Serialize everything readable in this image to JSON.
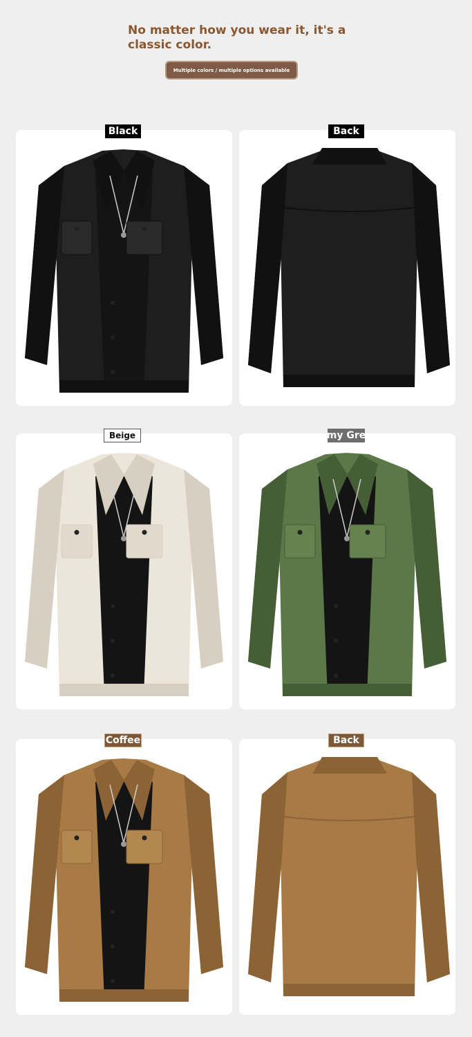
{
  "header": {
    "headline": "No matter how you wear it, it's a\nclassic color.",
    "badge": "Multiple colors / multiple options available"
  },
  "products": [
    {
      "label": "Black",
      "view": "front",
      "color": "#1e1e1e",
      "shade": "#111111",
      "pocket": "#2a2a2a"
    },
    {
      "label": "Back",
      "view": "back",
      "color": "#1e1e1e",
      "shade": "#111111",
      "pocket": "#2a2a2a"
    },
    {
      "label": "Beige",
      "view": "front",
      "color": "#ece6da",
      "shade": "#d6cfc2",
      "pocket": "#e0d9cc"
    },
    {
      "label": "my Gre",
      "view": "front",
      "color": "#5c7848",
      "shade": "#465e36",
      "pocket": "#66834f"
    },
    {
      "label": "Coffee",
      "view": "front",
      "color": "#a87b46",
      "shade": "#8c6334",
      "pocket": "#b38850"
    },
    {
      "label": "Back",
      "view": "back",
      "color": "#a87b46",
      "shade": "#8c6334",
      "pocket": "#b38850"
    }
  ]
}
